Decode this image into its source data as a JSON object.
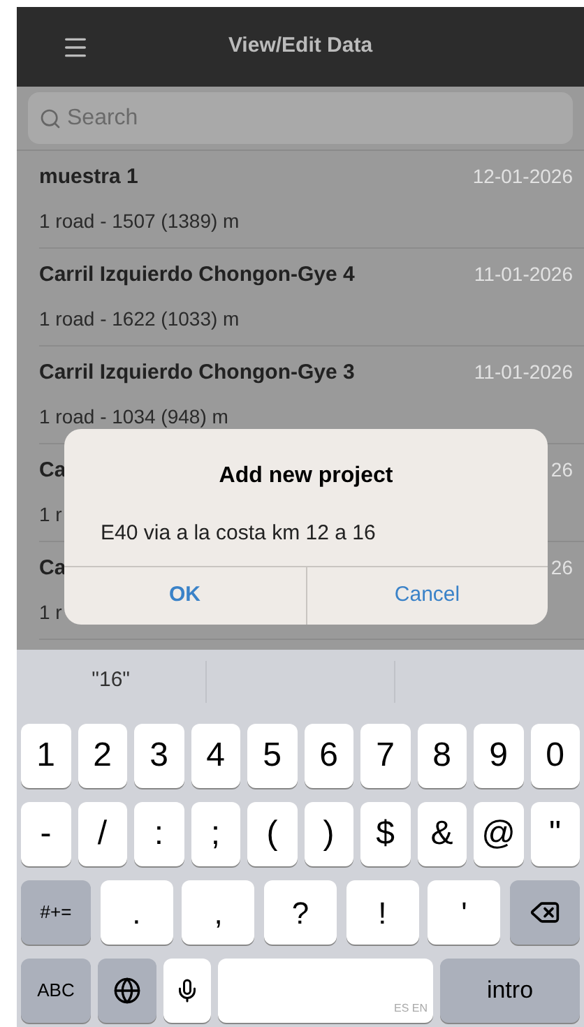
{
  "header": {
    "title": "View/Edit Data"
  },
  "search": {
    "placeholder": "Search"
  },
  "projects": [
    {
      "name": "muestra 1",
      "date": "12-01-2026",
      "detail": "1 road - 1507 (1389) m"
    },
    {
      "name": "Carril Izquierdo Chongon-Gye 4",
      "date": "11-01-2026",
      "detail": "1 road - 1622 (1033) m"
    },
    {
      "name": "Carril Izquierdo Chongon-Gye 3",
      "date": "11-01-2026",
      "detail": "1 road - 1034 (948) m"
    },
    {
      "name": "Ca",
      "date": "26",
      "detail": "1 r"
    },
    {
      "name": "Ca",
      "date": "26",
      "detail": "1 r"
    }
  ],
  "dialog": {
    "title": "Add new project",
    "value": "E40 via a la costa km 12 a 16",
    "buttons": [
      {
        "label": "OK",
        "bold": true
      },
      {
        "label": "Cancel",
        "bold": false
      }
    ]
  },
  "keyboard": {
    "suggestion": "\"16\"",
    "rows": [
      {
        "keys": [
          {
            "kind": "char",
            "label": "1"
          },
          {
            "kind": "char",
            "label": "2"
          },
          {
            "kind": "char",
            "label": "3"
          },
          {
            "kind": "char",
            "label": "4"
          },
          {
            "kind": "char",
            "label": "5"
          },
          {
            "kind": "char",
            "label": "6"
          },
          {
            "kind": "char",
            "label": "7"
          },
          {
            "kind": "char",
            "label": "8"
          },
          {
            "kind": "char",
            "label": "9"
          },
          {
            "kind": "char",
            "label": "0"
          }
        ]
      },
      {
        "keys": [
          {
            "kind": "char",
            "label": "-"
          },
          {
            "kind": "char",
            "label": "/"
          },
          {
            "kind": "char",
            "label": ":"
          },
          {
            "kind": "char",
            "label": ";"
          },
          {
            "kind": "char",
            "label": "("
          },
          {
            "kind": "char",
            "label": ")"
          },
          {
            "kind": "char",
            "label": "$"
          },
          {
            "kind": "char",
            "label": "&"
          },
          {
            "kind": "char",
            "label": "@"
          },
          {
            "kind": "char",
            "label": "\""
          }
        ]
      },
      {
        "keys": [
          {
            "kind": "function",
            "label": "#+="
          },
          {
            "kind": "wide",
            "label": "."
          },
          {
            "kind": "wide",
            "label": ","
          },
          {
            "kind": "wide",
            "label": "?"
          },
          {
            "kind": "wide",
            "label": "!"
          },
          {
            "kind": "wide",
            "label": "'"
          },
          {
            "kind": "delete"
          }
        ]
      },
      {
        "keys": [
          {
            "kind": "function",
            "label": "ABC"
          },
          {
            "kind": "globe"
          },
          {
            "kind": "mic"
          },
          {
            "kind": "space",
            "label": "ES EN"
          },
          {
            "kind": "return",
            "label": "intro"
          }
        ]
      }
    ]
  }
}
